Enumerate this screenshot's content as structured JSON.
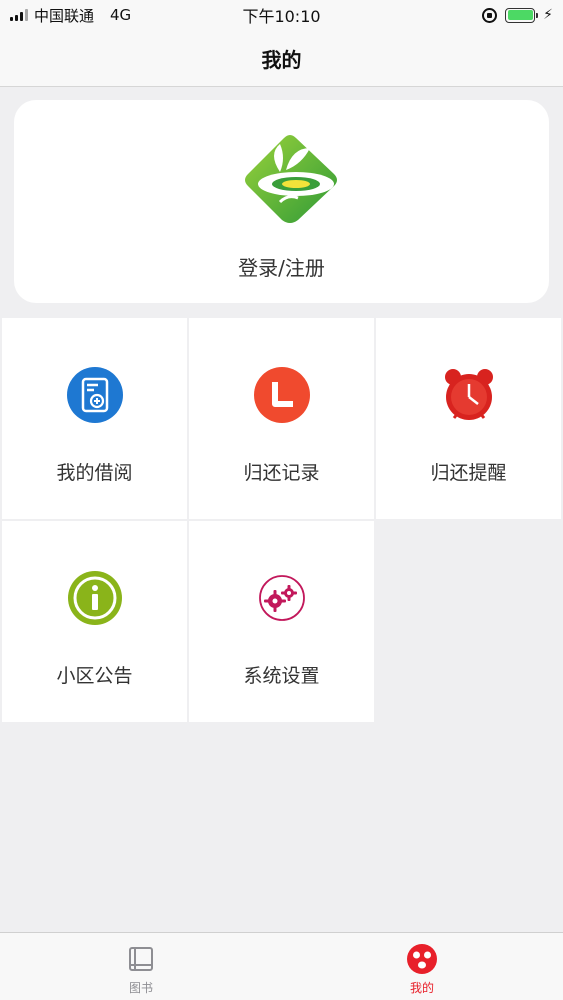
{
  "status_bar": {
    "carrier": "中国联通",
    "network": "4G",
    "time": "下午10:10"
  },
  "nav": {
    "title": "我的"
  },
  "login": {
    "label": "登录/注册"
  },
  "menu": [
    {
      "label": "我的借阅",
      "icon": "borrow-card-icon",
      "color": "#1e78d2"
    },
    {
      "label": "归还记录",
      "icon": "clock-record-icon",
      "color": "#f04a2e"
    },
    {
      "label": "归还提醒",
      "icon": "alarm-clock-icon",
      "color": "#d8231f"
    },
    {
      "label": "小区公告",
      "icon": "info-icon",
      "color": "#8ab41a"
    },
    {
      "label": "系统设置",
      "icon": "gears-icon",
      "color": "#c2185b"
    }
  ],
  "tabs": [
    {
      "label": "图书",
      "icon": "book-icon",
      "active": false
    },
    {
      "label": "我的",
      "icon": "face-icon",
      "active": true
    }
  ],
  "colors": {
    "accent": "#e8202a",
    "battery": "#4cd964",
    "background": "#efeff1"
  }
}
